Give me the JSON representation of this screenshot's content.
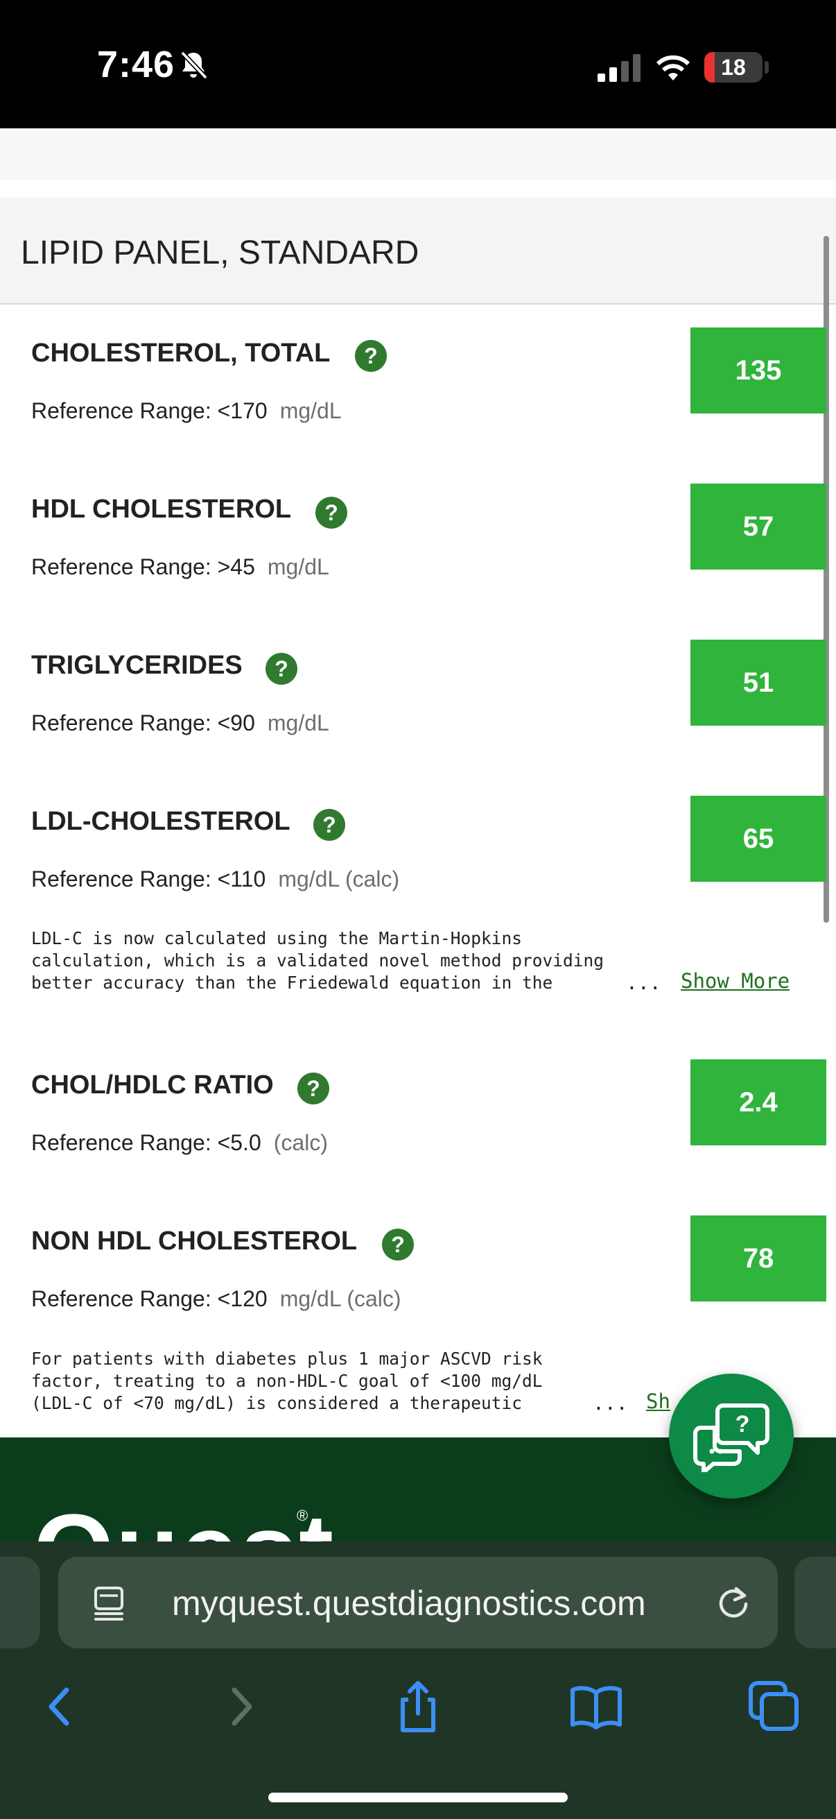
{
  "status_bar": {
    "time": "7:46",
    "battery": "18",
    "battery_level": 0.18,
    "icons": [
      "bell-slash-icon",
      "cellular-signal-icon",
      "wifi-icon",
      "battery-icon"
    ]
  },
  "panel": {
    "title": "LIPID PANEL, STANDARD"
  },
  "tests": [
    {
      "name": "CHOLESTEROL, TOTAL",
      "reference": "Reference Range: <170",
      "unit": "mg/dL",
      "value": "135"
    },
    {
      "name": "HDL CHOLESTEROL",
      "reference": "Reference Range: >45",
      "unit": "mg/dL",
      "value": "57"
    },
    {
      "name": "TRIGLYCERIDES",
      "reference": "Reference Range: <90",
      "unit": "mg/dL",
      "value": "51"
    },
    {
      "name": "LDL-CHOLESTEROL",
      "reference": "Reference Range: <110",
      "unit": "mg/dL (calc)",
      "value": "65",
      "note": "LDL-C is now calculated using the Martin-Hopkins\ncalculation, which is a validated novel method providing\nbetter accuracy than the Friedewald equation in the"
    },
    {
      "name": "CHOL/HDLC RATIO",
      "reference": "Reference Range: <5.0",
      "unit": "(calc)",
      "value": "2.4"
    },
    {
      "name": "NON HDL CHOLESTEROL",
      "reference": "Reference Range: <120",
      "unit": "mg/dL (calc)",
      "value": "78",
      "note": "For patients with diabetes plus 1 major ASCVD risk\nfactor, treating to a non-HDL-C goal of <100 mg/dL\n(LDL-C of <70 mg/dL) is considered a therapeutic"
    }
  ],
  "help_symbol": "?",
  "ellipsis": "...",
  "show_more_label": "Show More",
  "show_more_clipped": "Sh",
  "footer": {
    "logo": "Quest",
    "reg_mark": "®"
  },
  "browser": {
    "url": "myquest.questdiagnostics.com"
  },
  "colors": {
    "value_box": "#30b43c",
    "help_icon": "#2f7a2f",
    "footer": "#0b3d1c",
    "chat_button": "#0d8a45",
    "browser_chrome": "#1f3626",
    "link": "#1f6e1f",
    "ios_blue": "#3d8ef5"
  }
}
